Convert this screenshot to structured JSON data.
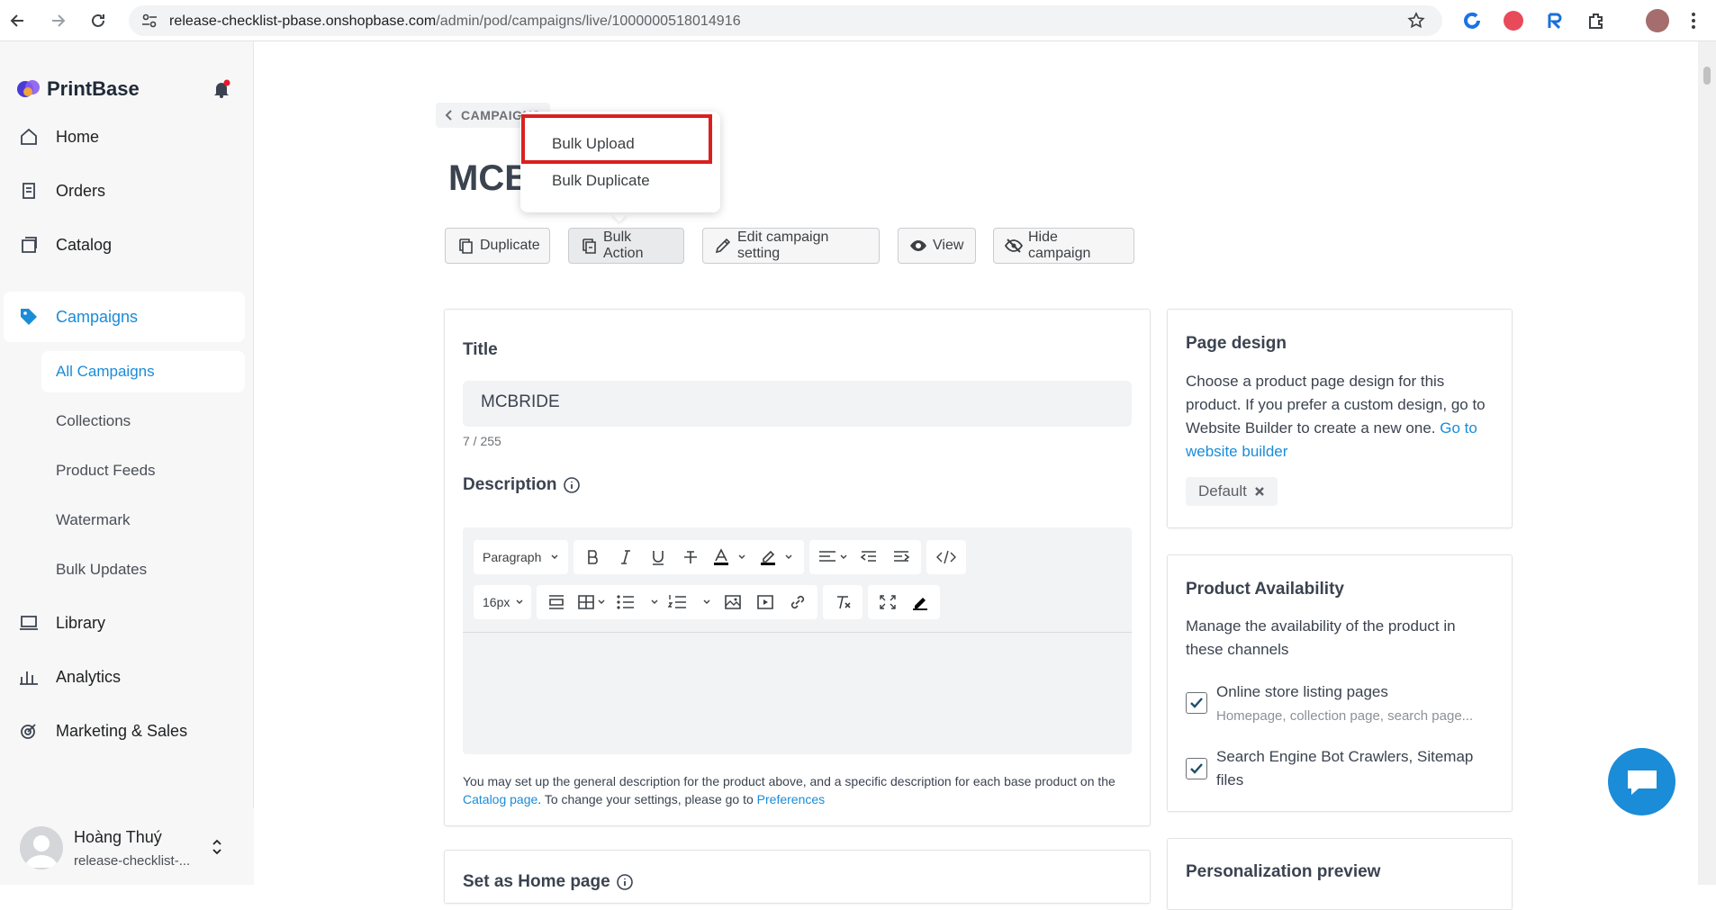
{
  "browser": {
    "url_host": "release-checklist-pbase.onshopbase.com",
    "url_path": "/admin/pod/campaigns/live/1000000518014916"
  },
  "sidebar": {
    "brand": "PrintBase",
    "items": [
      {
        "label": "Home"
      },
      {
        "label": "Orders"
      },
      {
        "label": "Catalog"
      },
      {
        "label": "Campaigns"
      },
      {
        "label": "Library"
      },
      {
        "label": "Analytics"
      },
      {
        "label": "Marketing & Sales"
      }
    ],
    "sub_items": [
      {
        "label": "All Campaigns"
      },
      {
        "label": "Collections"
      },
      {
        "label": "Product Feeds"
      },
      {
        "label": "Watermark"
      },
      {
        "label": "Bulk Updates"
      }
    ],
    "user": {
      "name": "Hoàng Thuý",
      "store": "release-checklist-..."
    }
  },
  "header": {
    "back_label": "CAMPAIGNS",
    "title": "MCBRIDE"
  },
  "actions": {
    "duplicate": "Duplicate",
    "bulk_action": "Bulk Action",
    "edit_setting": "Edit campaign setting",
    "view": "View",
    "hide": "Hide campaign"
  },
  "dropdown": {
    "items": [
      "Bulk Upload",
      "Bulk Duplicate"
    ]
  },
  "form": {
    "title_label": "Title",
    "title_value": "MCBRIDE",
    "char_count": "7 / 255",
    "description_label": "Description",
    "paragraph_select": "Paragraph",
    "font_size_select": "16px",
    "help_before": "You may set up the general description for the product above, and a specific description for each base product on the ",
    "help_link1": "Catalog page",
    "help_middle": ". To change your settings, please go to ",
    "help_link2": "Preferences",
    "home_page_label": "Set as Home page"
  },
  "page_design": {
    "title": "Page design",
    "text": "Choose a product page design for this product. If you prefer a custom design, go to Website Builder to create a new one.",
    "link": "Go to website builder",
    "tag": "Default"
  },
  "availability": {
    "title": "Product Availability",
    "text": "Manage the availability of the product in these channels",
    "option1": "Online store listing pages",
    "option1_sub": "Homepage, collection page, search page...",
    "option2": "Search Engine Bot Crawlers, Sitemap files"
  },
  "personalization": {
    "title": "Personalization preview"
  },
  "colors": {
    "accent": "#1a8cd8",
    "highlight": "#d9201f"
  }
}
